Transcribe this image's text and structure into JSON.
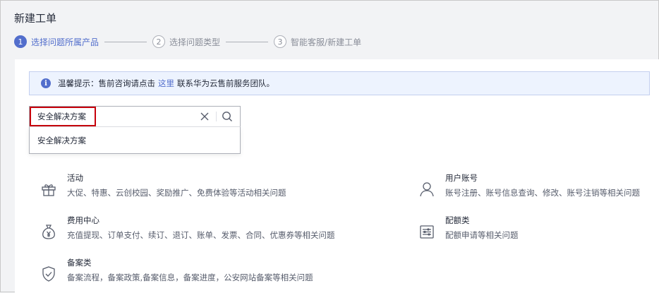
{
  "page": {
    "title": "新建工单"
  },
  "steps": [
    {
      "num": "1",
      "label": "选择问题所属产品"
    },
    {
      "num": "2",
      "label": "选择问题类型"
    },
    {
      "num": "3",
      "label": "智能客服/新建工单"
    }
  ],
  "notice": {
    "prefix": "温馨提示：售前咨询请点击",
    "link": "这里",
    "suffix": "联系华为云售前服务团队。"
  },
  "search": {
    "value": "安全解决方案",
    "dropdown_option": "安全解决方案"
  },
  "categories": [
    {
      "title": "活动",
      "desc": "大促、特惠、云创校园、奖励推广、免费体验等活动相关问题",
      "icon": "gift-icon"
    },
    {
      "title": "用户账号",
      "desc": "账号注册、账号信息查询、修改、账号注销等相关问题",
      "icon": "user-icon"
    },
    {
      "title": "费用中心",
      "desc": "充值提现、订单支付、续订、退订、账单、发票、合同、优惠券等相关问题",
      "icon": "money-bag-icon"
    },
    {
      "title": "配额类",
      "desc": "配额申请等相关问题",
      "icon": "quota-list-icon"
    },
    {
      "title": "备案类",
      "desc": "备案流程，备案政策,备案信息，备案进度，公安网站备案等相关问题",
      "icon": "shield-check-icon"
    }
  ],
  "colors": {
    "accent": "#526ecc",
    "highlight_frame": "#c7000b"
  }
}
